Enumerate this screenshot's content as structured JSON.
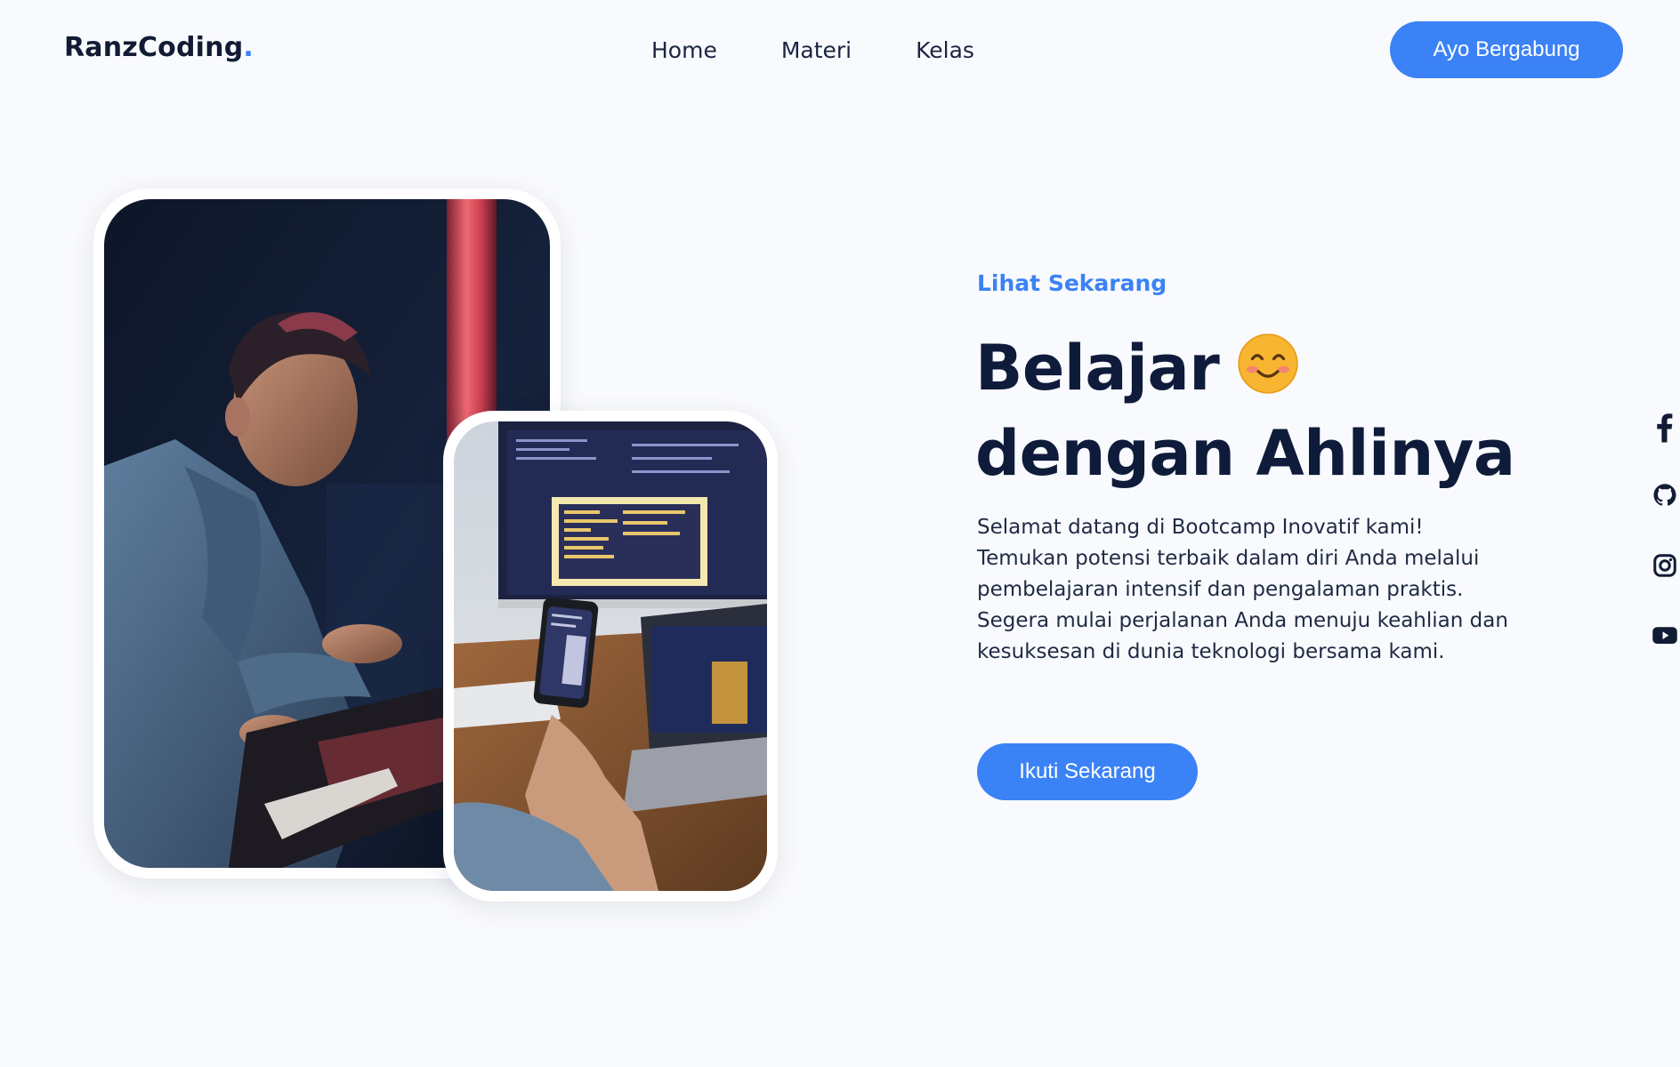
{
  "header": {
    "logo_text": "RanzCoding",
    "logo_dot": ".",
    "nav": [
      {
        "label": "Home"
      },
      {
        "label": "Materi"
      },
      {
        "label": "Kelas"
      }
    ],
    "join_button": "Ayo Bergabung"
  },
  "hero": {
    "eyebrow": "Lihat Sekarang",
    "headline_line1": "Belajar",
    "headline_emoji": "smiling-face-icon",
    "headline_line2": "dengan Ahlinya",
    "description": "Selamat datang di Bootcamp Inovatif kami! Temukan potensi terbaik dalam diri Anda melalui pembelajaran intensif dan pengalaman praktis. Segera mulai perjalanan Anda menuju keahlian dan kesuksesan di dunia teknologi bersama kami.",
    "cta_button": "Ikuti Sekarang",
    "images": [
      {
        "subject": "programmer-at-keyboard-photo"
      },
      {
        "subject": "phone-and-monitors-code-photo"
      }
    ]
  },
  "social": [
    {
      "icon": "facebook-icon"
    },
    {
      "icon": "github-icon"
    },
    {
      "icon": "instagram-icon"
    },
    {
      "icon": "youtube-icon"
    }
  ],
  "colors": {
    "accent": "#3b82f6",
    "text_dark": "#0f1b3a",
    "background": "#f9fafd"
  }
}
